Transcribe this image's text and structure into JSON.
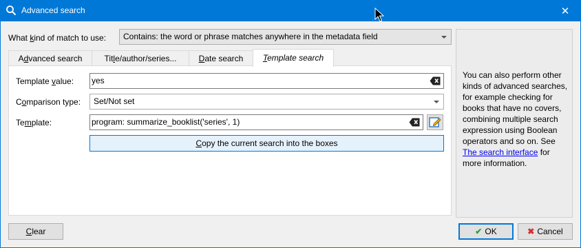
{
  "window": {
    "title": "Advanced search",
    "close_label": "✕"
  },
  "match": {
    "label_pre": "What ",
    "label_mnemonic": "k",
    "label_post": "ind of match to use:",
    "value": "Contains: the word or phrase matches anywhere in the metadata field"
  },
  "tabs": [
    {
      "pre": "A",
      "mnemonic": "d",
      "post": "vanced search"
    },
    {
      "pre": "Tit",
      "mnemonic": "l",
      "post": "e/author/series..."
    },
    {
      "pre": "",
      "mnemonic": "D",
      "post": "ate search"
    },
    {
      "pre": "",
      "mnemonic": "T",
      "post": "emplate search"
    }
  ],
  "template_search": {
    "template_value_pre": "Template ",
    "template_value_mnemonic": "v",
    "template_value_post": "alue:",
    "template_value": "yes",
    "comparison_pre": "C",
    "comparison_mnemonic": "o",
    "comparison_post": "mparison type:",
    "comparison_value": "Set/Not set",
    "template_label_pre": "Te",
    "template_label_mnemonic": "m",
    "template_label_post": "plate:",
    "template": "program: summarize_booklist('series', 1)",
    "copy_pre": "",
    "copy_mnemonic": "C",
    "copy_post": "opy the current search into the boxes"
  },
  "help": {
    "text_before": "You can also perform other kinds of advanced searches, for example checking for books that have no covers, combining multiple search expression using Boolean operators and so on. See ",
    "link": "The search interface",
    "text_after": " for more information."
  },
  "footer": {
    "clear_mnemonic": "C",
    "clear_post": "lear",
    "ok_label": "OK",
    "cancel_label": "Cancel"
  },
  "colors": {
    "titlebar": "#0078d7",
    "ok_icon": "#2e9e3a",
    "cancel_icon": "#d32f2f",
    "link": "#0000ee"
  }
}
